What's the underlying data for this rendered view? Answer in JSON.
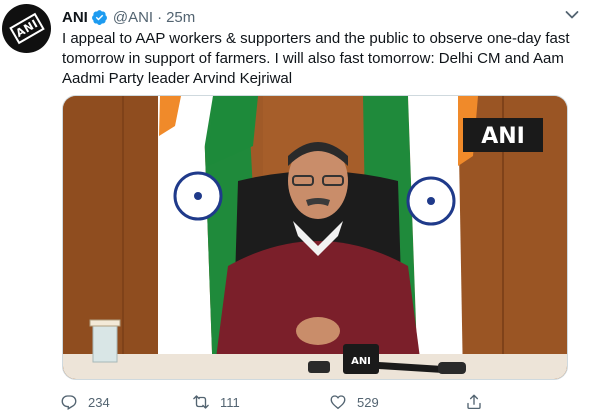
{
  "tweet": {
    "author_name": "ANI",
    "handle": "@ANI",
    "separator": "·",
    "time": "25m",
    "text": "I appeal to AAP workers & supporters and the public to observe one-day fast tomorrow in support of farmers. I will also fast tomorrow: Delhi CM and Aam Aadmi Party leader Arvind Kejriwal",
    "avatar_logo": "ANI",
    "media_watermark": "ANI",
    "mic_label": "ANI"
  },
  "actions": {
    "reply_count": "234",
    "retweet_count": "111",
    "like_count": "529"
  },
  "colors": {
    "verified": "#1d9bf0",
    "muted_text": "#536471",
    "text": "#0f1419"
  },
  "icons": [
    "verified-icon",
    "chevron-down-icon",
    "reply-icon",
    "retweet-icon",
    "like-icon",
    "share-icon"
  ]
}
